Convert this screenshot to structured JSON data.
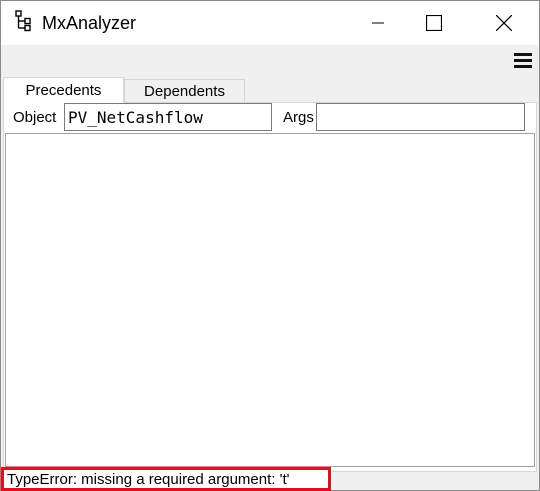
{
  "window": {
    "title": "MxAnalyzer",
    "icon": "tree-structure-icon"
  },
  "titlebar_buttons": [
    "minimize-icon",
    "maximize-icon",
    "close-icon"
  ],
  "menu": {
    "icon": "hamburger-menu-icon"
  },
  "tabs": [
    {
      "label": "Precedents",
      "active": true
    },
    {
      "label": "Dependents",
      "active": false
    }
  ],
  "form": {
    "object_label": "Object",
    "object_value": "PV_NetCashflow",
    "args_label": "Args",
    "args_value": ""
  },
  "status": {
    "message": "TypeError: missing a required argument: 't'",
    "highlight_color": "#e01020"
  }
}
